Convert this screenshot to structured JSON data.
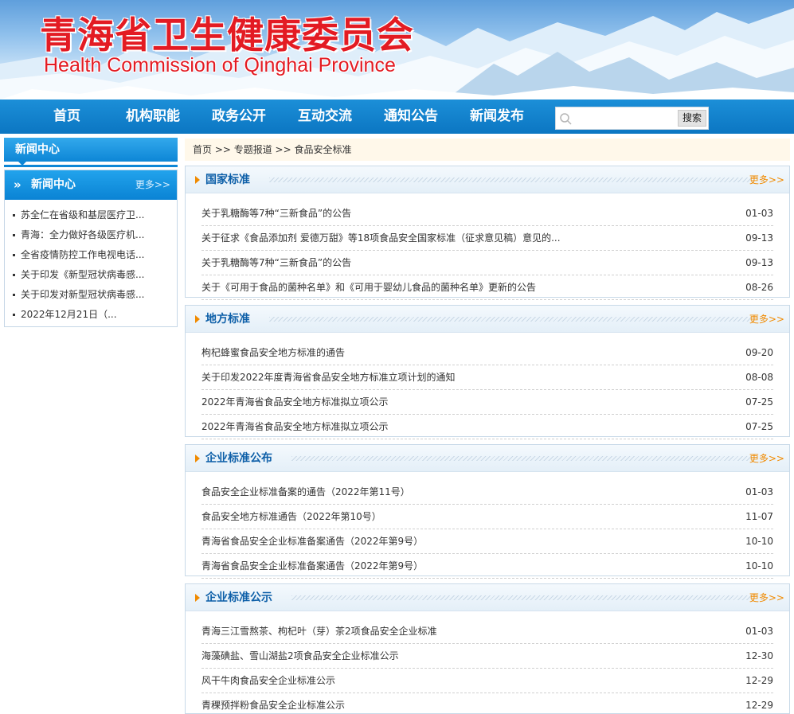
{
  "header": {
    "title_cn": "青海省卫生健康委员会",
    "title_en": "Health Commission of Qinghai Province"
  },
  "nav": {
    "items": [
      "首页",
      "机构职能",
      "政务公开",
      "互动交流",
      "通知公告",
      "新闻发布"
    ],
    "search_placeholder": "",
    "search_button": "搜索"
  },
  "sidebar": {
    "title": "新闻中心",
    "box_title": "新闻中心",
    "more": "更多>>",
    "items": [
      "苏全仁在省级和基层医疗卫...",
      "青海：全力做好各级医疗机...",
      "全省疫情防控工作电视电话...",
      "关于印发《新型冠状病毒感...",
      "关于印发对新型冠状病毒感...",
      "2022年12月21日（..."
    ]
  },
  "breadcrumb": "首页 >> 专题报道 >> 食品安全标准",
  "sections": [
    {
      "title": "国家标准",
      "more": "更多>>",
      "items": [
        {
          "title": "关于乳糖酶等7种“三新食品”的公告",
          "date": "01-03"
        },
        {
          "title": "关于征求《食品添加剂 爱德万甜》等18项食品安全国家标准（征求意见稿）意见的...",
          "date": "09-13"
        },
        {
          "title": "关于乳糖酶等7种“三新食品”的公告",
          "date": "09-13"
        },
        {
          "title": "关于《可用于食品的菌种名单》和《可用于婴幼儿食品的菌种名单》更新的公告",
          "date": "08-26"
        }
      ]
    },
    {
      "title": "地方标准",
      "more": "更多>>",
      "items": [
        {
          "title": "枸杞蜂蜜食品安全地方标准的通告",
          "date": "09-20"
        },
        {
          "title": "关于印发2022年度青海省食品安全地方标准立项计划的通知",
          "date": "08-08"
        },
        {
          "title": "2022年青海省食品安全地方标准拟立项公示",
          "date": "07-25"
        },
        {
          "title": "2022年青海省食品安全地方标准拟立项公示",
          "date": "07-25"
        }
      ]
    },
    {
      "title": "企业标准公布",
      "more": "更多>>",
      "items": [
        {
          "title": "食品安全企业标准备案的通告（2022年第11号）",
          "date": "01-03"
        },
        {
          "title": "食品安全地方标准通告（2022年第10号）",
          "date": "11-07"
        },
        {
          "title": "青海省食品安全企业标准备案通告（2022年第9号）",
          "date": "10-10"
        },
        {
          "title": "青海省食品安全企业标准备案通告（2022年第9号）",
          "date": "10-10"
        }
      ]
    },
    {
      "title": "企业标准公示",
      "more": "更多>>",
      "items": [
        {
          "title": "青海三江雪熬茶、枸杞叶（芽）茶2项食品安全企业标准",
          "date": "01-03"
        },
        {
          "title": "海藻碘盐、雪山湖盐2项食品安全企业标准公示",
          "date": "12-30"
        },
        {
          "title": "风干牛肉食品安全企业标准公示",
          "date": "12-29"
        },
        {
          "title": "青稞预拌粉食品安全企业标准公示",
          "date": "12-29"
        }
      ]
    }
  ],
  "colors": {
    "nav_blue": "#0b76c2",
    "title_red": "#e31b23",
    "section_title": "#0d5fa8",
    "accent_orange": "#f08a00"
  }
}
